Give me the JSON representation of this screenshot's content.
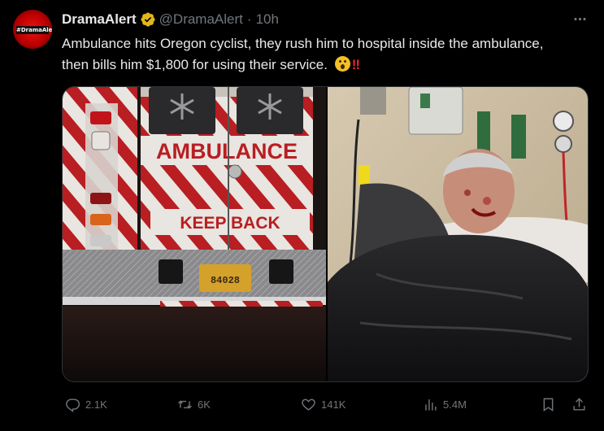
{
  "author": {
    "name": "DramaAlert",
    "handle": "@DramaAlert",
    "separator": "·",
    "time": "10h",
    "avatar_label": "#DramaAlert",
    "verified_icon": "verified-badge-gold"
  },
  "menu": {
    "label": "···"
  },
  "tweet": {
    "text": "Ambulance hits Oregon cyclist, they rush him to hospital inside the ambulance, then bills him $1,800 for using their service.",
    "emoji_face": "astonished-face",
    "emoji_bang": "‼"
  },
  "media": {
    "left": {
      "ambulance_text": "AMBULANCE",
      "keep_back_text": "KEEP BACK",
      "plate_text": "84028"
    },
    "right": {}
  },
  "actions": {
    "reply_count": "2.1K",
    "retweet_count": "6K",
    "like_count": "141K",
    "views_count": "5.4M"
  },
  "colors": {
    "background": "#000000",
    "text": "#e7e9ea",
    "muted": "#71767b",
    "verified": "#e2b719",
    "accent_red": "#f4212e"
  }
}
